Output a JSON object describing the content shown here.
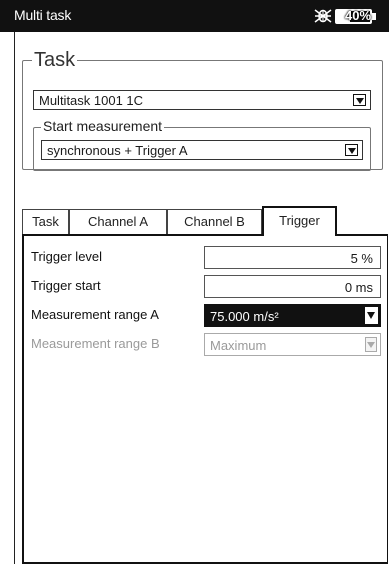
{
  "titlebar": {
    "title": "Multi task",
    "status_icon": "bug-icon",
    "battery": {
      "label": "40%",
      "level_fraction": 0.4
    }
  },
  "task_group": {
    "legend": "Task",
    "task_select": {
      "value": "Multitask 1001 1C"
    },
    "start_group": {
      "legend": "Start measurement",
      "start_select": {
        "value": "synchronous + Trigger A"
      }
    }
  },
  "tabs": [
    {
      "label": "Task",
      "active": false
    },
    {
      "label": "Channel A",
      "active": false
    },
    {
      "label": "Channel B",
      "active": false
    },
    {
      "label": "Trigger",
      "active": true
    }
  ],
  "trigger": {
    "rows": [
      {
        "label": "Trigger level",
        "value": "5 %",
        "kind": "input",
        "enabled": true
      },
      {
        "label": "Trigger start",
        "value": "0 ms",
        "kind": "input",
        "enabled": true
      },
      {
        "label": "Measurement range A",
        "value": "75.000 m/s²",
        "kind": "select",
        "enabled": true,
        "focused": true
      },
      {
        "label": "Measurement range B",
        "value": "Maximum",
        "kind": "select",
        "enabled": false
      }
    ]
  },
  "colors": {
    "titlebar_bg": "#111111",
    "focus_bg": "#111111",
    "disabled_text": "#9a9a9a"
  }
}
